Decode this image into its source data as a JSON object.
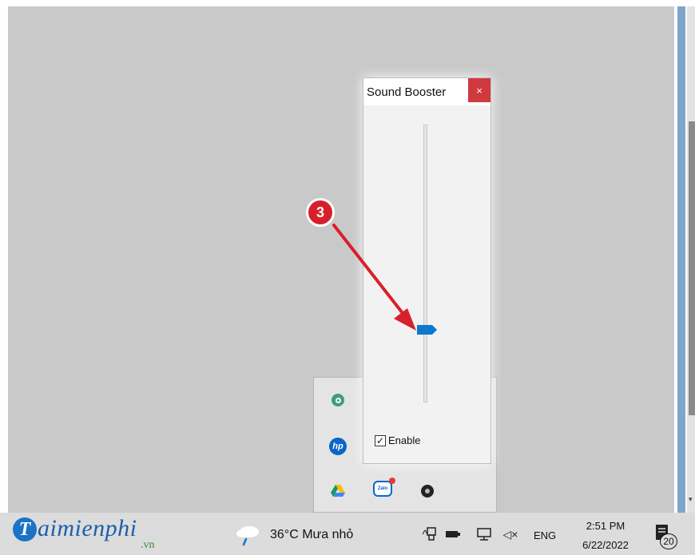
{
  "sound_booster": {
    "title": "Sound Booster",
    "close_glyph": "×",
    "slider_level": 0.26,
    "enable_checked": true,
    "enable_label": "Enable"
  },
  "annotation": {
    "step_number": "3",
    "color": "#d8202c"
  },
  "tray_overflow": {
    "icons": [
      "green-circle-app-icon",
      "hp-icon",
      "google-drive-icon",
      "zalo-icon",
      "disc-icon"
    ]
  },
  "taskbar": {
    "logo": {
      "brand": "aimienphi",
      "suffix": ".vn",
      "initial": "T"
    },
    "weather": {
      "temperature": "36°C",
      "condition": "Mưa nhỏ"
    },
    "chevron_glyph": "^",
    "language": "ENG",
    "time": "2:51 PM",
    "date": "6/22/2022",
    "notification_count": "20"
  },
  "colors": {
    "accent_blue": "#0b79d0",
    "close_red": "#d0393e"
  }
}
